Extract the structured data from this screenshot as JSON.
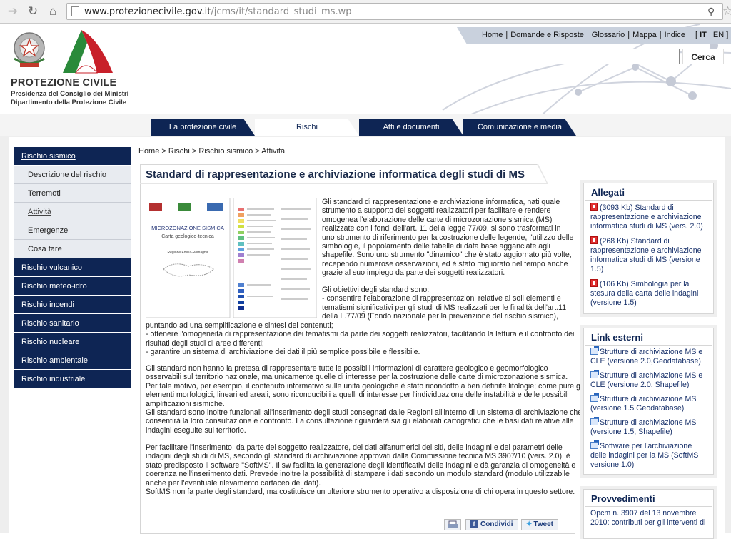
{
  "browser": {
    "url_domain": "www.protezionecivile.gov.it",
    "url_path": "/jcms/it/standard_studi_ms.wp"
  },
  "header": {
    "org_name": "PROTEZIONE CIVILE",
    "org_line1": "Presidenza del Consiglio dei Ministri",
    "org_line2": "Dipartimento della Protezione Civile",
    "toplinks": [
      "Home",
      "Domande e Risposte",
      "Glossario",
      "Mappa",
      "Indice"
    ],
    "lang": [
      "IT",
      "EN"
    ],
    "search_button": "Cerca",
    "search_value": ""
  },
  "tabs": [
    "La protezione civile",
    "Rischi",
    "Atti e documenti",
    "Comunicazione e media"
  ],
  "sidebar": {
    "items": [
      {
        "label": "Rischio sismico",
        "kind": "main"
      },
      {
        "label": "Descrizione del rischio",
        "kind": "sub"
      },
      {
        "label": "Terremoti",
        "kind": "sub"
      },
      {
        "label": "Attività",
        "kind": "sub"
      },
      {
        "label": "Emergenze",
        "kind": "sub"
      },
      {
        "label": "Cosa fare",
        "kind": "sub"
      },
      {
        "label": "Rischio vulcanico",
        "kind": "main"
      },
      {
        "label": "Rischio meteo-idro",
        "kind": "main"
      },
      {
        "label": "Rischio incendi",
        "kind": "main"
      },
      {
        "label": "Rischio sanitario",
        "kind": "main"
      },
      {
        "label": "Rischio nucleare",
        "kind": "main"
      },
      {
        "label": "Rischio ambientale",
        "kind": "main"
      },
      {
        "label": "Rischio industriale",
        "kind": "main"
      }
    ]
  },
  "breadcrumb": [
    "Home",
    "Rischi",
    "Rischio sismico",
    "Attività"
  ],
  "breadcrumb_sep": " > ",
  "page_title": "Standard di rappresentazione e archiviazione informatica degli studi di MS",
  "thumbnail": {
    "title": "MICROZONAZIONE SISMICA",
    "subtitle": "Carta geologico-tecnica",
    "region": "Regione Emilia-Romagna"
  },
  "article": {
    "intro": [
      "Gli standard di rappresentazione e archiviazione informatica, nati quale",
      "strumento a supporto dei soggetti realizzatori per facilitare e rendere",
      "omogenea l'elaborazione delle carte di microzonazione sismica (MS)",
      "realizzate con i fondi dell'art. 11 della legge 77/09, si sono trasformati in",
      "uno strumento di riferimento per la costruzione delle legende, l'utilizzo delle",
      "simbologie, il popolamento delle tabelle di data base agganciate agli",
      "shapefile. Sono uno strumento \"dinamico\" che è stato aggiornato più volte,",
      "recependo numerose osservazioni, ed è stato migliorato nel tempo anche",
      "grazie al suo impiego da parte dei soggetti realizzatori."
    ],
    "objectives_narrow": [
      "Gli obiettivi degli standard sono:",
      "- consentire l'elaborazione di rappresentazioni relative ai soli elementi e",
      "tematismi significativi per gli studi di MS realizzati per le finalità dell'art.11",
      "della L.77/09 (Fondo nazionale per la prevenzione del rischio sismico),"
    ],
    "objectives_wide": [
      "puntando ad una semplificazione e sintesi dei contenuti;",
      "- ottenere l'omogeneità di rappresentazione dei tematismi da parte dei soggetti realizzatori, facilitando la lettura e il confronto dei",
      "risultati degli studi di aree differenti;",
      "- garantire un sistema di archiviazione dei dati il più semplice possibile e flessibile."
    ],
    "para2": [
      "Gli standard non hanno la pretesa di rappresentare tutte le possibili informazioni di carattere geologico e geomorfologico",
      "osservabili sul territorio nazionale, ma unicamente quelle di interesse per la costruzione delle carte di microzonazione sismica.",
      "Per tale motivo, per esempio, il contenuto informativo sulle unità geologiche è stato ricondotto a ben definite litologie; come pure gli",
      "elementi morfologici, lineari ed areali, sono riconducibili a quelli di interesse per l'individuazione delle instabilità e delle possibili",
      "amplificazioni sismiche.",
      "Gli standard sono inoltre funzionali all'inserimento degli studi consegnati dalle Regioni all'interno di un sistema di archiviazione che",
      "consentirà la loro consultazione e confronto. La consultazione riguarderà sia gli elaborati cartografici che le basi dati relative alle",
      "indagini eseguite sul territorio."
    ],
    "para3": [
      "Per facilitare l'inserimento, da parte del soggetto realizzatore, dei dati alfanumerici dei siti, delle indagini e dei parametri delle",
      "indagini degli studi di MS, secondo gli standard di archiviazione approvati dalla Commissione tecnica MS 3907/10 (vers. 2.0), è",
      "stato predisposto il software \"SoftMS\". Il sw facilita la generazione degli identificativi delle indagini e dà garanzia di omogeneità e",
      "coerenza nell'inserimento dati. Prevede inoltre la possibilità di stampare i dati secondo un modulo standard (modulo utilizzabile",
      "anche per l'eventuale rilevamento cartaceo dei dati).",
      "SoftMS non fa parte degli standard, ma costituisce un ulteriore strumento operativo a disposizione di chi opera in questo settore."
    ]
  },
  "share": {
    "print": "",
    "facebook": "Condividi",
    "twitter": "Tweet"
  },
  "allegati": {
    "title": "Allegati",
    "items": [
      {
        "size": "(3093 Kb)",
        "text": "Standard di rappresentazione e archiviazione informatica studi di MS (vers. 2.0)"
      },
      {
        "size": "(268 Kb)",
        "text": "Standard di rappresentazione e archiviazione informatica studi di MS (versione 1.5)"
      },
      {
        "size": "(106 Kb)",
        "text": "Simbologia per la stesura della carta delle indagini (versione 1.5)"
      }
    ]
  },
  "link_esterni": {
    "title": "Link esterni",
    "items": [
      "Strutture di archiviazione MS e CLE (versione 2.0,Geodatabase)",
      "Strutture di archiviazione MS e CLE (versione 2.0, Shapefile)",
      "Strutture di archiviazione MS (versione 1.5 Geodatabase)",
      "Strutture di archiviazione MS (versione 1.5, Shapefile)",
      "Software per l'archiviazione delle indagini per la MS (SoftMS versione 1.0)"
    ]
  },
  "provvedimenti": {
    "title": "Provvedimenti",
    "items": [
      "Opcm n. 3907 del 13 novembre 2010: contributi per gli interventi di"
    ]
  },
  "colors": {
    "navy": "#0e2554",
    "link": "#17306a",
    "logo_green": "#2a8a3a",
    "logo_red": "#c8202a"
  }
}
